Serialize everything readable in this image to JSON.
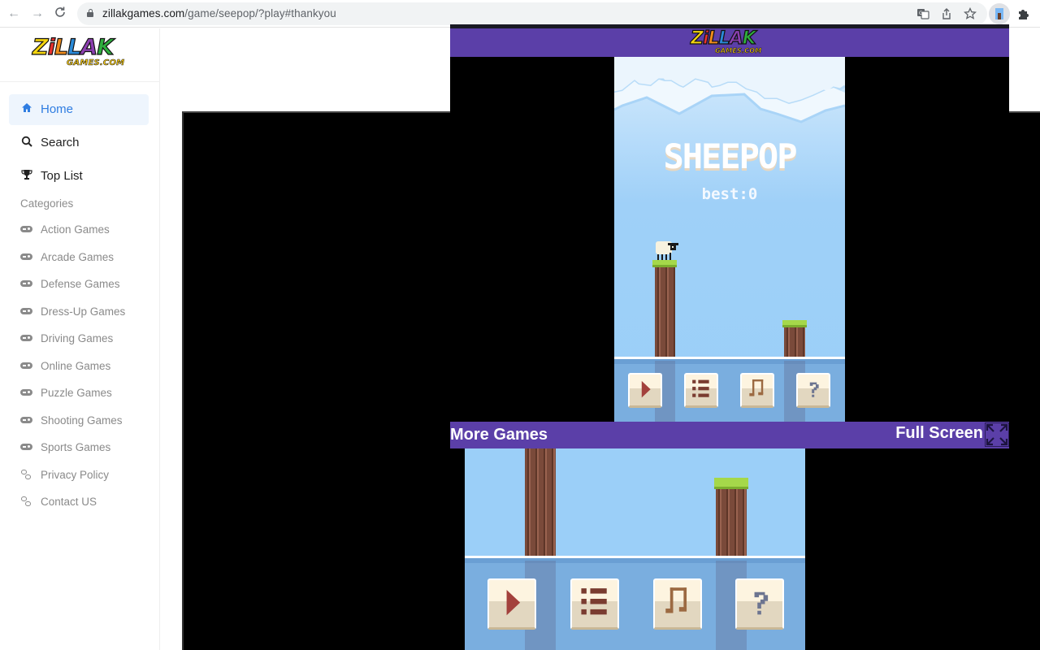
{
  "browser": {
    "url_host": "zillakgames.com",
    "url_path": "/game/seepop/?play#thankyou",
    "nav": {
      "back": "←",
      "forward": "→",
      "reload": "C"
    },
    "icons": [
      "translate-icon",
      "share-icon",
      "bookmark-star-icon",
      "extension-icon",
      "extensions-puzzle-icon"
    ]
  },
  "sidebar": {
    "logo": {
      "main": "ZiLLAK",
      "sub": "GAMES.COM"
    },
    "nav": [
      {
        "label": "Home",
        "icon": "home-icon",
        "active": true
      },
      {
        "label": "Search",
        "icon": "search-icon",
        "active": false
      },
      {
        "label": "Top List",
        "icon": "trophy-icon",
        "active": false
      }
    ],
    "categories_heading": "Categories",
    "categories": [
      {
        "label": "Action Games",
        "icon": "gamepad-icon"
      },
      {
        "label": "Arcade Games",
        "icon": "gamepad-icon"
      },
      {
        "label": "Defense Games",
        "icon": "gamepad-icon"
      },
      {
        "label": "Dress-Up Games",
        "icon": "gamepad-icon"
      },
      {
        "label": "Driving Games",
        "icon": "gamepad-icon"
      },
      {
        "label": "Online Games",
        "icon": "gamepad-icon"
      },
      {
        "label": "Puzzle Games",
        "icon": "gamepad-icon"
      },
      {
        "label": "Shooting Games",
        "icon": "gamepad-icon"
      },
      {
        "label": "Sports Games",
        "icon": "gamepad-icon"
      },
      {
        "label": "Privacy Policy",
        "icon": "link-icon"
      },
      {
        "label": "Contact US",
        "icon": "link-icon"
      }
    ]
  },
  "popup": {
    "logo": {
      "main": "ZiLLAK",
      "sub": "GAMES.COM"
    },
    "more_games": "More Games",
    "full_screen": "Full Screen",
    "colors": {
      "bar": "#5b3fa8"
    }
  },
  "game": {
    "title": "SHEEPOP",
    "best_label": "best:0",
    "buttons": [
      {
        "name": "play",
        "icon": "play-icon"
      },
      {
        "name": "leaderboard",
        "icon": "list-icon"
      },
      {
        "name": "music",
        "icon": "music-note-icon"
      },
      {
        "name": "help",
        "icon": "question-icon"
      }
    ]
  }
}
